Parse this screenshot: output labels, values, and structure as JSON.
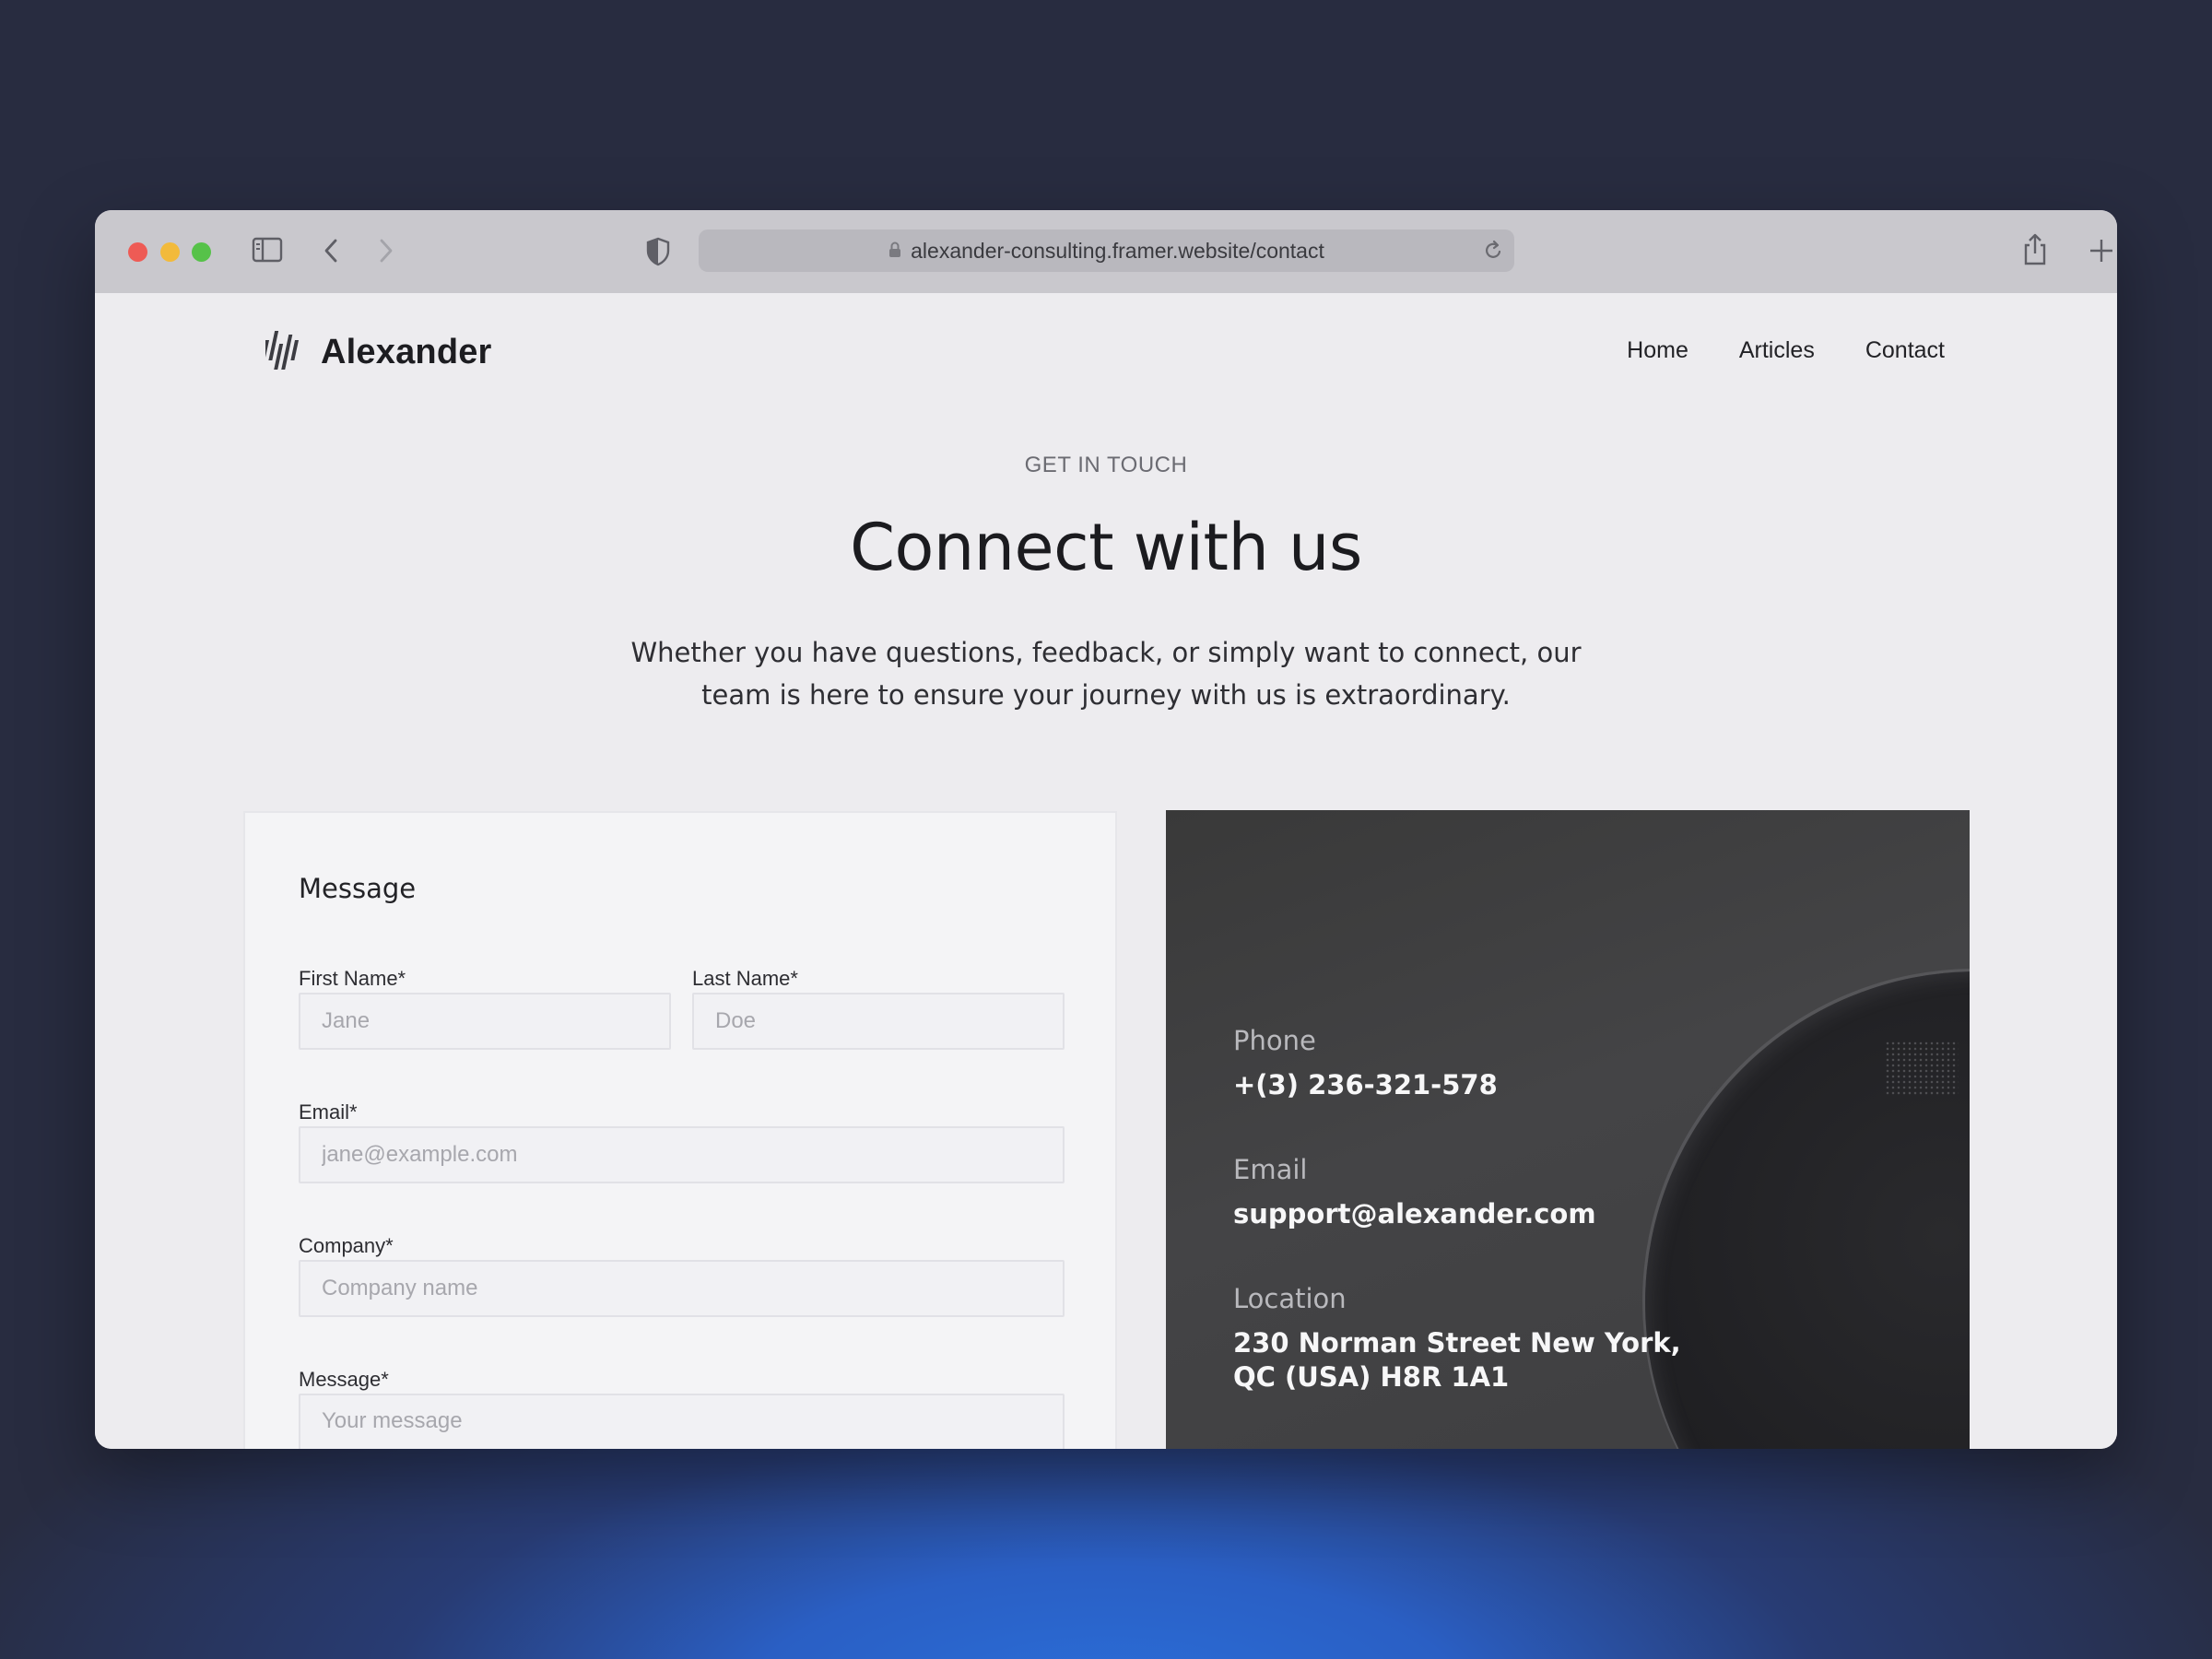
{
  "browser": {
    "url": "alexander-consulting.framer.website/contact"
  },
  "site": {
    "brand_name": "Alexander",
    "nav": [
      {
        "label": "Home"
      },
      {
        "label": "Articles"
      },
      {
        "label": "Contact"
      }
    ]
  },
  "hero": {
    "eyebrow": "GET IN TOUCH",
    "title": "Connect with us",
    "lead_line1": "Whether you have questions, feedback, or simply want to connect, our",
    "lead_line2": "team is here to ensure your journey with us is extraordinary."
  },
  "form": {
    "title": "Message",
    "first_name": {
      "label": "First Name*",
      "placeholder": "Jane"
    },
    "last_name": {
      "label": "Last Name*",
      "placeholder": "Doe"
    },
    "email": {
      "label": "Email*",
      "placeholder": "jane@example.com"
    },
    "company": {
      "label": "Company*",
      "placeholder": "Company name"
    },
    "message": {
      "label": "Message*",
      "placeholder": "Your message"
    }
  },
  "contact_info": {
    "phone_label": "Phone",
    "phone_value": "+(3) 236-321-578",
    "email_label": "Email",
    "email_value": "support@alexander.com",
    "location_label": "Location",
    "location_line1": "230 Norman Street New York,",
    "location_line2": "QC (USA) H8R 1A1"
  },
  "colors": {
    "page_bg": "#edecef",
    "dark_card": "#3f3f41",
    "backdrop": "#282c40",
    "accent_glow": "#2b6ed9"
  },
  "icons": [
    "sidebar-icon",
    "back-icon",
    "forward-icon",
    "shield-icon",
    "lock-icon",
    "reload-icon",
    "share-icon",
    "new-tab-icon",
    "tabs-overview-icon",
    "logo-bars-icon"
  ]
}
